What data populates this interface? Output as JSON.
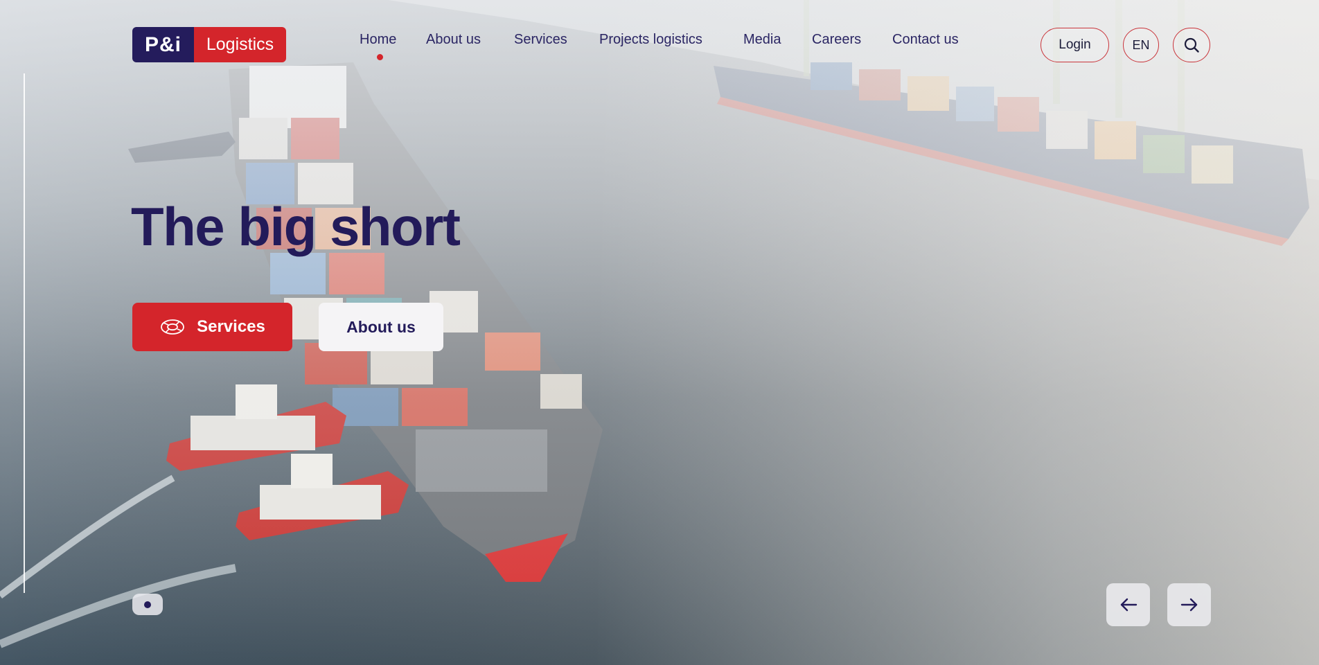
{
  "brand": {
    "mark": "P&i",
    "word": "Logistics"
  },
  "nav": {
    "items": [
      {
        "label": "Home",
        "active": true
      },
      {
        "label": "About us"
      },
      {
        "label": "Services"
      },
      {
        "label": "Projects logistics"
      },
      {
        "label": "Media"
      },
      {
        "label": "Careers"
      },
      {
        "label": "Contact us"
      }
    ]
  },
  "header": {
    "login_label": "Login",
    "lang_label": "EN",
    "search_icon": "search-icon"
  },
  "hero": {
    "title": "The big short",
    "primary_label": "Services",
    "primary_icon": "lifebuoy-icon",
    "secondary_label": "About us"
  },
  "slider": {
    "current": 1,
    "total": 1,
    "prev_icon": "arrow-left-icon",
    "next_icon": "arrow-right-icon"
  },
  "colors": {
    "brand_navy": "#241c5c",
    "brand_red": "#d4252b",
    "text_dark": "#231b5a"
  }
}
